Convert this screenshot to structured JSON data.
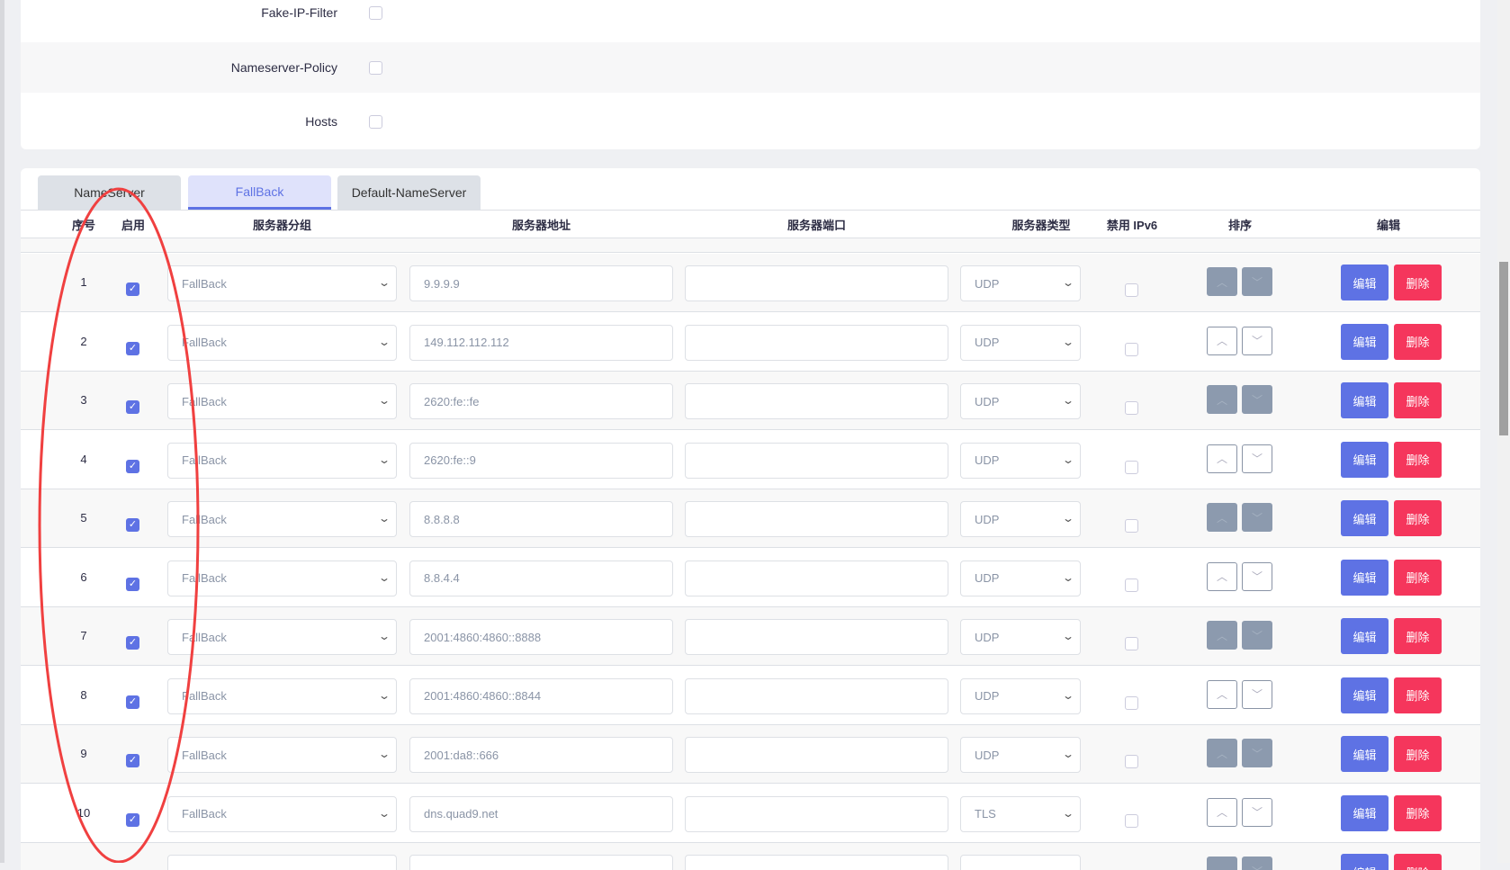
{
  "options": [
    {
      "label": "Fake-IP-Filter",
      "checked": false
    },
    {
      "label": "Nameserver-Policy",
      "checked": false
    },
    {
      "label": "Hosts",
      "checked": false
    }
  ],
  "tabs": [
    {
      "label": "NameServer",
      "active": false
    },
    {
      "label": "FallBack",
      "active": true
    },
    {
      "label": "Default-NameServer",
      "active": false
    }
  ],
  "headers": {
    "index": "序号",
    "enabled": "启用",
    "group": "服务器分组",
    "address": "服务器地址",
    "port": "服务器端口",
    "type": "服务器类型",
    "ipv6": "禁用 IPv6",
    "sort": "排序",
    "edit": "编辑"
  },
  "buttons": {
    "edit": "编辑",
    "delete": "删除"
  },
  "rows": [
    {
      "index": "1",
      "group": "FallBack",
      "address": "9.9.9.9",
      "port": "",
      "type": "UDP"
    },
    {
      "index": "2",
      "group": "FallBack",
      "address": "149.112.112.112",
      "port": "",
      "type": "UDP"
    },
    {
      "index": "3",
      "group": "FallBack",
      "address": "2620:fe::fe",
      "port": "",
      "type": "UDP"
    },
    {
      "index": "4",
      "group": "FallBack",
      "address": "2620:fe::9",
      "port": "",
      "type": "UDP"
    },
    {
      "index": "5",
      "group": "FallBack",
      "address": "8.8.8.8",
      "port": "",
      "type": "UDP"
    },
    {
      "index": "6",
      "group": "FallBack",
      "address": "8.8.4.4",
      "port": "",
      "type": "UDP"
    },
    {
      "index": "7",
      "group": "FallBack",
      "address": "2001:4860:4860::8888",
      "port": "",
      "type": "UDP"
    },
    {
      "index": "8",
      "group": "FallBack",
      "address": "2001:4860:4860::8844",
      "port": "",
      "type": "UDP"
    },
    {
      "index": "9",
      "group": "FallBack",
      "address": "2001:da8::666",
      "port": "",
      "type": "UDP"
    },
    {
      "index": "10",
      "group": "FallBack",
      "address": "dns.quad9.net",
      "port": "",
      "type": "TLS"
    }
  ],
  "colors": {
    "accent": "#5e72e4",
    "danger": "#f5365c",
    "annotation": "#f04040"
  }
}
